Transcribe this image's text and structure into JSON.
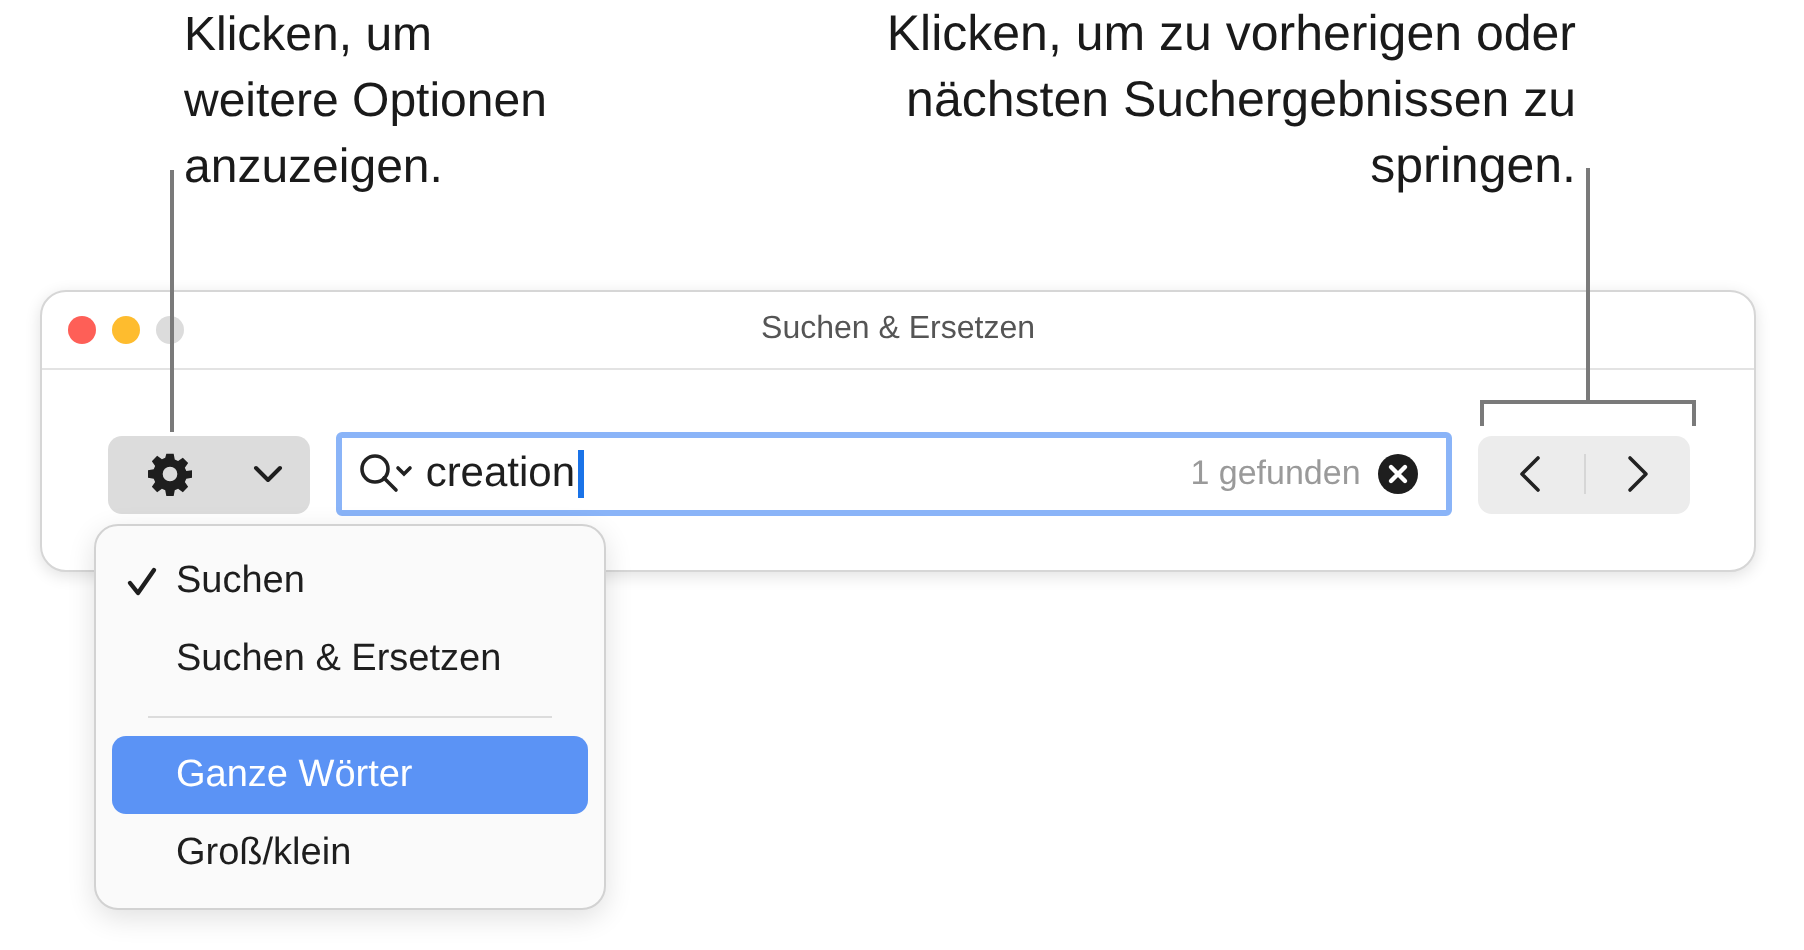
{
  "callouts": [
    {
      "text": "Klicken, um weitere Optionen anzuzeigen.",
      "kind": "left"
    },
    {
      "text": "Klicken, um zu vorherigen oder nächsten Suchergebnissen zu springen.",
      "kind": "right"
    }
  ],
  "window": {
    "title": "Suchen & Ersetzen"
  },
  "search": {
    "value": "creation",
    "count": "1 gefunden"
  },
  "menu": {
    "items": [
      {
        "kind": "item",
        "label": "Suchen",
        "checked": true,
        "selected": false
      },
      {
        "kind": "item",
        "label": "Suchen & Ersetzen",
        "checked": false,
        "selected": false
      },
      {
        "kind": "separator"
      },
      {
        "kind": "item",
        "label": "Ganze Wörter",
        "checked": false,
        "selected": true
      },
      {
        "kind": "item",
        "label": "Groß/klein",
        "checked": false,
        "selected": false
      }
    ]
  }
}
